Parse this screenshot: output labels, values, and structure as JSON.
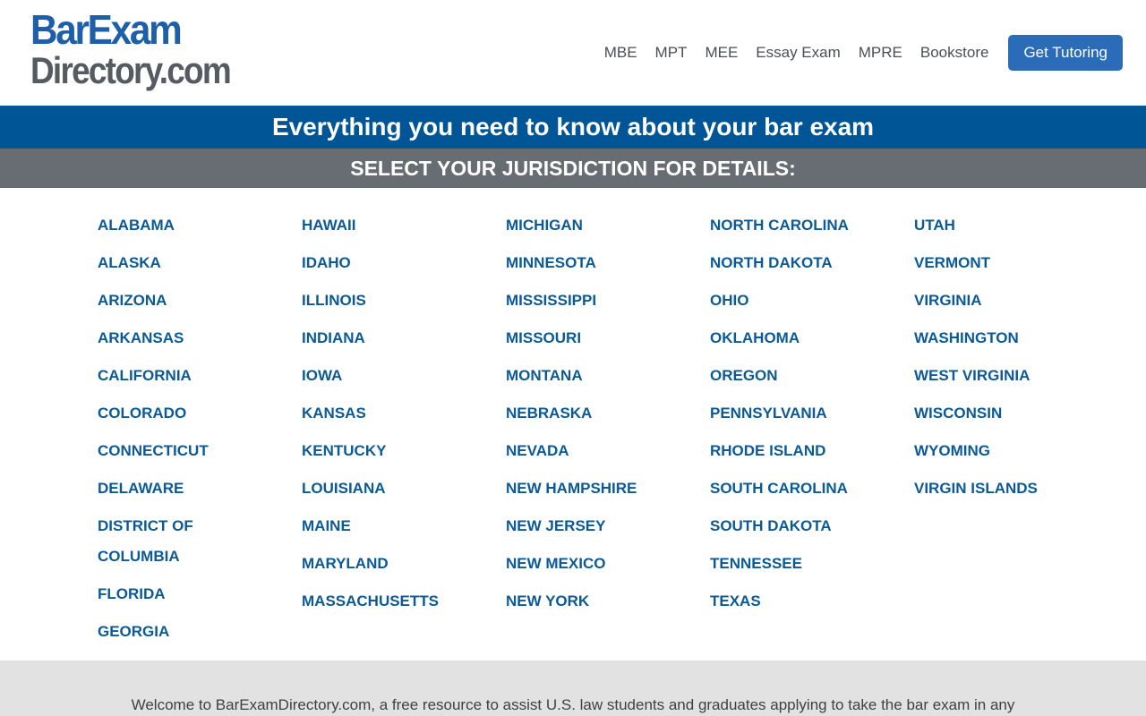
{
  "logo": {
    "line1": "BarExam",
    "line2": "Directory.com"
  },
  "nav": {
    "items": [
      "MBE",
      "MPT",
      "MEE",
      "Essay Exam",
      "MPRE",
      "Bookstore"
    ],
    "cta": "Get Tutoring"
  },
  "banner": {
    "title": "Everything you need to know about your bar exam",
    "subtitle": "SELECT YOUR JURISDICTION FOR DETAILS:"
  },
  "jurisdictions": [
    [
      "ALABAMA",
      "ALASKA",
      "ARIZONA",
      "ARKANSAS",
      "CALIFORNIA",
      "COLORADO",
      "CONNECTICUT",
      "DELAWARE",
      "DISTRICT OF COLUMBIA",
      "FLORIDA",
      "GEORGIA"
    ],
    [
      "HAWAII",
      "IDAHO",
      "ILLINOIS",
      "INDIANA",
      "IOWA",
      "KANSAS",
      "KENTUCKY",
      "LOUISIANA",
      "MAINE",
      "MARYLAND",
      "MASSACHUSETTS"
    ],
    [
      "MICHIGAN",
      "MINNESOTA",
      "MISSISSIPPI",
      "MISSOURI",
      "MONTANA",
      "NEBRASKA",
      "NEVADA",
      "NEW HAMPSHIRE",
      "NEW JERSEY",
      "NEW MEXICO",
      "NEW YORK"
    ],
    [
      "NORTH CAROLINA",
      "NORTH DAKOTA",
      "OHIO",
      "OKLAHOMA",
      "OREGON",
      "PENNSYLVANIA",
      "RHODE ISLAND",
      "SOUTH CAROLINA",
      "SOUTH DAKOTA",
      "TENNESSEE",
      "TEXAS"
    ],
    [
      "UTAH",
      "VERMONT",
      "VIRGINIA",
      "WASHINGTON",
      "WEST VIRGINIA",
      "WISCONSIN",
      "WYOMING",
      "VIRGIN ISLANDS"
    ]
  ],
  "footer": {
    "intro": "Welcome to BarExamDirectory.com, a free resource to assist U.S. law students and graduates applying to take the bar exam in any"
  }
}
